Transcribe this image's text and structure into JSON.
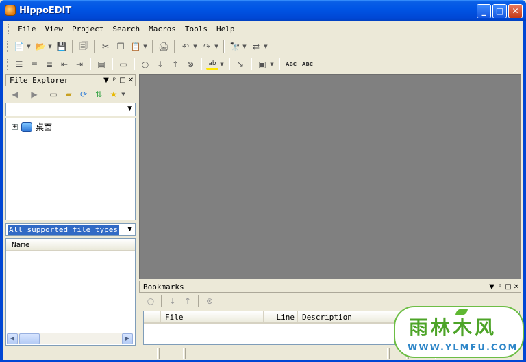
{
  "window": {
    "title": "HippoEDIT",
    "controls": {
      "minimize": "_",
      "maximize": "□",
      "close": "✕"
    }
  },
  "menu": [
    "File",
    "View",
    "Project",
    "Search",
    "Macros",
    "Tools",
    "Help"
  ],
  "toolbar1": [
    {
      "name": "new-file",
      "icon": "📄"
    },
    {
      "name": "open-file",
      "icon": "📂"
    },
    {
      "name": "save",
      "icon": "💾"
    },
    {
      "name": "save-all",
      "icon": "🗐"
    },
    {
      "name": "cut",
      "icon": "✂"
    },
    {
      "name": "copy",
      "icon": "❐"
    },
    {
      "name": "paste",
      "icon": "📋"
    },
    {
      "name": "print",
      "icon": "🖨"
    },
    {
      "name": "undo",
      "icon": "↶"
    },
    {
      "name": "redo",
      "icon": "↷"
    },
    {
      "name": "find",
      "icon": "🔭"
    },
    {
      "name": "replace",
      "icon": "⇄"
    }
  ],
  "toolbar2": [
    {
      "name": "indent",
      "icon": "☰"
    },
    {
      "name": "align",
      "icon": "≡"
    },
    {
      "name": "comment",
      "icon": "≣"
    },
    {
      "name": "outdent",
      "icon": "⇤"
    },
    {
      "name": "tab",
      "icon": "⇥"
    },
    {
      "name": "format",
      "icon": "▤"
    },
    {
      "name": "window",
      "icon": "▭"
    },
    {
      "name": "bookmark-toggle",
      "icon": "○"
    },
    {
      "name": "bookmark-next",
      "icon": "↓"
    },
    {
      "name": "bookmark-prev",
      "icon": "↑"
    },
    {
      "name": "bookmark-clear",
      "icon": "⊗"
    },
    {
      "name": "highlight",
      "icon": "ab"
    },
    {
      "name": "goto",
      "icon": "↘"
    },
    {
      "name": "display",
      "icon": "▣"
    },
    {
      "name": "spell-check",
      "icon": "ABC"
    },
    {
      "name": "spell-auto",
      "icon": "ABC"
    }
  ],
  "file_explorer": {
    "title": "File Explorer",
    "controls": {
      "dropdown": "▼",
      "pin": "ᵖ",
      "maximize": "□",
      "close": "✕"
    },
    "tree_root": "桌面",
    "filter_value": "All supported file types",
    "list_column": "Name"
  },
  "bookmarks": {
    "title": "Bookmarks",
    "columns": [
      "File",
      "Line",
      "Description"
    ]
  },
  "watermark": {
    "cn": "雨林木风",
    "url": "WWW.YLMFU.COM"
  }
}
